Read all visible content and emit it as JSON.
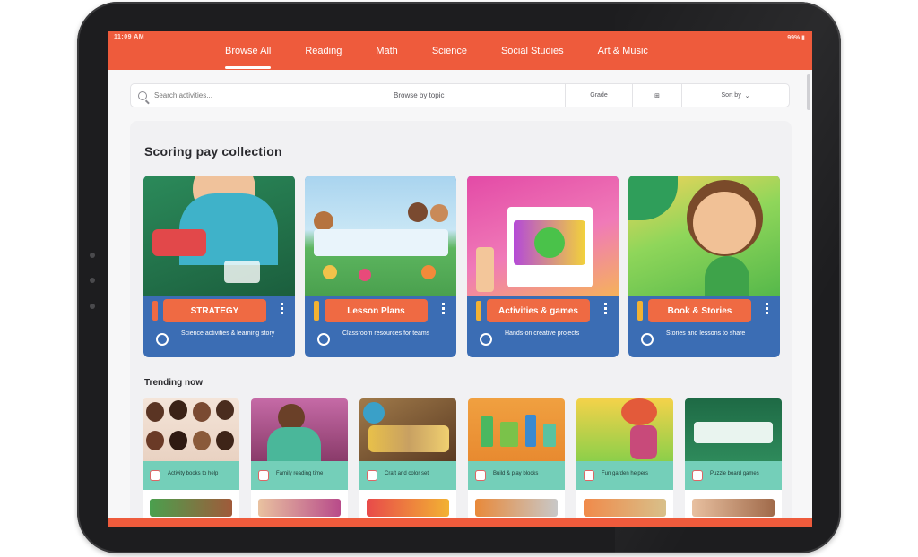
{
  "status": {
    "left": "11:09 AM",
    "right": "99% ▮"
  },
  "nav": {
    "items": [
      "Browse All",
      "Reading",
      "Math",
      "Science",
      "Social Studies",
      "Art & Music"
    ],
    "active": 0
  },
  "search": {
    "placeholder": "Search activities...",
    "center_label": "Browse by topic",
    "grade_label": "Grade",
    "filter_label": "⊞",
    "sort_label": "Sort by"
  },
  "featured": {
    "title": "Scoring pay collection",
    "cards": [
      {
        "pill": "STRATEGY",
        "footer": "Science activities & learning story",
        "colors": [
          "#1f7a4d",
          "#33a06a"
        ]
      },
      {
        "pill": "Lesson Plans",
        "footer": "Classroom resources for teams",
        "colors": [
          "#9ac8e8",
          "#57b35d"
        ]
      },
      {
        "pill": "Activities & games",
        "footer": "Hands-on creative projects",
        "colors": [
          "#e84aa8",
          "#f6a84a"
        ]
      },
      {
        "pill": "Book & Stories",
        "footer": "Stories and lessons to share",
        "colors": [
          "#57c24f",
          "#f2c54a"
        ]
      }
    ]
  },
  "recent": {
    "title": "Trending now",
    "tiles": [
      {
        "text": "Activity books to help",
        "colors": [
          "#6b3b2a",
          "#d9b08a"
        ]
      },
      {
        "text": "Family reading time",
        "colors": [
          "#b84b8a",
          "#e7c1a0"
        ]
      },
      {
        "text": "Craft and color set",
        "colors": [
          "#8a5b3a",
          "#caa35c"
        ]
      },
      {
        "text": "Build & play blocks",
        "colors": [
          "#e8893a",
          "#6fbf5a"
        ]
      },
      {
        "text": "Fun garden helpers",
        "colors": [
          "#e35a3a",
          "#8ccf4a"
        ]
      },
      {
        "text": "Puzzle board games",
        "colors": [
          "#1e6a45",
          "#2e8a5b"
        ]
      }
    ]
  }
}
